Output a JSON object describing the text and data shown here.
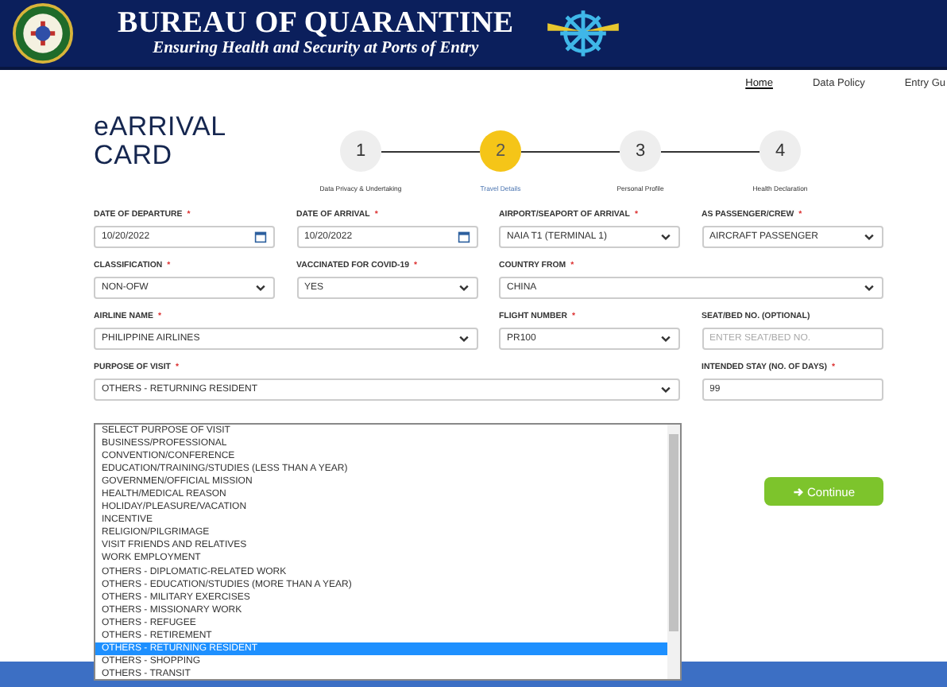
{
  "header": {
    "title": "BUREAU OF QUARANTINE",
    "subtitle": "Ensuring Health and Security at Ports of Entry"
  },
  "nav": [
    {
      "label": "Home",
      "selected": true
    },
    {
      "label": "Data Policy",
      "selected": false
    },
    {
      "label": "Entry Gu",
      "selected": false
    }
  ],
  "page_title": "eARRIVAL CARD",
  "steps": [
    {
      "number": "1",
      "label": "Data Privacy & Undertaking",
      "selected": false
    },
    {
      "number": "2",
      "label": "Travel Details",
      "selected": true
    },
    {
      "number": "3",
      "label": "Personal Profile",
      "selected": false
    },
    {
      "number": "4",
      "label": "Health Declaration",
      "selected": false
    }
  ],
  "form_rows": [
    [
      {
        "label": "DATE OF DEPARTURE",
        "required_mark": "*",
        "kind": "date",
        "value": "10/20/2022"
      },
      {
        "label": "DATE OF ARRIVAL",
        "required_mark": "*",
        "kind": "date",
        "value": "10/20/2022"
      },
      {
        "label": "AIRPORT/SEAPORT OF ARRIVAL",
        "required_mark": "*",
        "kind": "select",
        "value": "NAIA T1 (TERMINAL 1)"
      },
      {
        "label": "AS PASSENGER/CREW",
        "required_mark": "*",
        "kind": "select",
        "value": "AIRCRAFT PASSENGER"
      }
    ],
    [
      {
        "label": "CLASSIFICATION",
        "required_mark": "*",
        "kind": "select",
        "value": "NON-OFW"
      },
      {
        "label": "VACCINATED FOR COVID-19",
        "required_mark": "*",
        "kind": "select",
        "value": "YES"
      },
      {
        "label": "COUNTRY FROM",
        "required_mark": "*",
        "kind": "select",
        "value": "CHINA"
      }
    ],
    [
      {
        "label": "AIRLINE NAME",
        "required_mark": "*",
        "kind": "select",
        "value": "PHILIPPINE AIRLINES"
      },
      {
        "label": "FLIGHT NUMBER",
        "required_mark": "*",
        "kind": "select",
        "value": "PR100"
      },
      {
        "label": "SEAT/BED NO. (OPTIONAL)",
        "kind": "text",
        "placeholder": "ENTER SEAT/BED NO."
      }
    ],
    [
      {
        "label": "PURPOSE OF VISIT",
        "required_mark": "*",
        "kind": "select",
        "value": "OTHERS - RETURNING RESIDENT"
      },
      {
        "label": "INTENDED STAY (NO. OF DAYS)",
        "required_mark": "*",
        "kind": "text",
        "value": "99"
      }
    ]
  ],
  "purpose_dropdown": {
    "open": true,
    "options": [
      {
        "label": "SELECT PURPOSE OF VISIT",
        "selected": false
      },
      {
        "label": "BUSINESS/PROFESSIONAL",
        "selected": false
      },
      {
        "label": "CONVENTION/CONFERENCE",
        "selected": false
      },
      {
        "label": "EDUCATION/TRAINING/STUDIES (LESS THAN A YEAR)",
        "selected": false
      },
      {
        "label": "GOVERNMEN/OFFICIAL MISSION",
        "selected": false
      },
      {
        "label": "HEALTH/MEDICAL REASON",
        "selected": false
      },
      {
        "label": "HOLIDAY/PLEASURE/VACATION",
        "selected": false
      },
      {
        "label": "INCENTIVE",
        "selected": false
      },
      {
        "label": "RELIGION/PILGRIMAGE",
        "selected": false
      },
      {
        "label": "VISIT FRIENDS AND RELATIVES",
        "selected": false
      },
      {
        "label": "WORK EMPLOYMENT",
        "selected": false
      },
      {
        "label": "OTHERS - DIPLOMATIC-RELATED WORK",
        "selected": false
      },
      {
        "label": "OTHERS - EDUCATION/STUDIES (MORE THAN A YEAR)",
        "selected": false
      },
      {
        "label": "OTHERS - MILITARY EXERCISES",
        "selected": false
      },
      {
        "label": "OTHERS - MISSIONARY WORK",
        "selected": false
      },
      {
        "label": "OTHERS - REFUGEE",
        "selected": false
      },
      {
        "label": "OTHERS - RETIREMENT",
        "selected": false
      },
      {
        "label": "OTHERS - RETURNING RESIDENT",
        "selected": true
      },
      {
        "label": "OTHERS - SHOPPING",
        "selected": false
      },
      {
        "label": "OTHERS - TRANSIT",
        "selected": false
      }
    ]
  },
  "continue_button": {
    "label": "Continue"
  }
}
